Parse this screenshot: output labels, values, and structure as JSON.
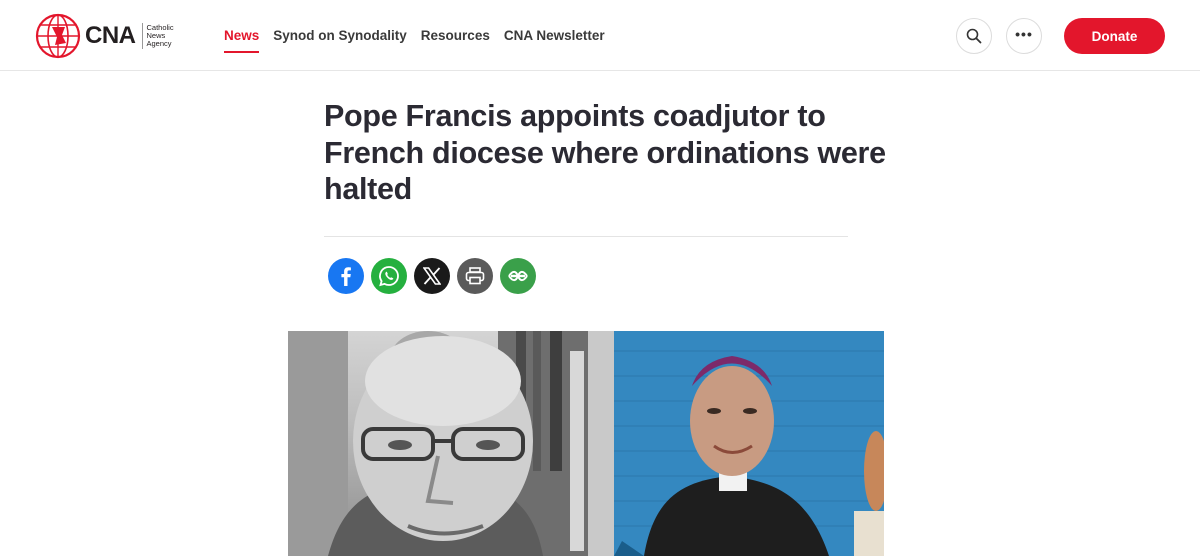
{
  "brand": {
    "name": "CNA",
    "subtitle_lines": [
      "Catholic",
      "News",
      "Agency"
    ],
    "accent_color": "#e3162c"
  },
  "nav": {
    "items": [
      {
        "label": "News",
        "active": true
      },
      {
        "label": "Synod on Synodality",
        "active": false
      },
      {
        "label": "Resources",
        "active": false
      },
      {
        "label": "CNA Newsletter",
        "active": false
      }
    ]
  },
  "header_actions": {
    "search_icon": "search-icon",
    "more_icon": "more-horizontal-icon",
    "more_glyph": "•••",
    "donate_label": "Donate"
  },
  "article": {
    "title": "Pope Francis appoints coadjutor to French diocese where ordinations were halted",
    "share_buttons": [
      {
        "name": "facebook-share",
        "icon": "facebook-icon",
        "color": "#1877f2"
      },
      {
        "name": "whatsapp-share",
        "icon": "whatsapp-icon",
        "color": "#25b03f"
      },
      {
        "name": "x-share",
        "icon": "x-icon",
        "color": "#1a1a1a"
      },
      {
        "name": "print-button",
        "icon": "print-icon",
        "color": "#5a5a5a"
      },
      {
        "name": "more-share",
        "icon": "share-more-icon",
        "color": "#3aa04a"
      }
    ]
  }
}
